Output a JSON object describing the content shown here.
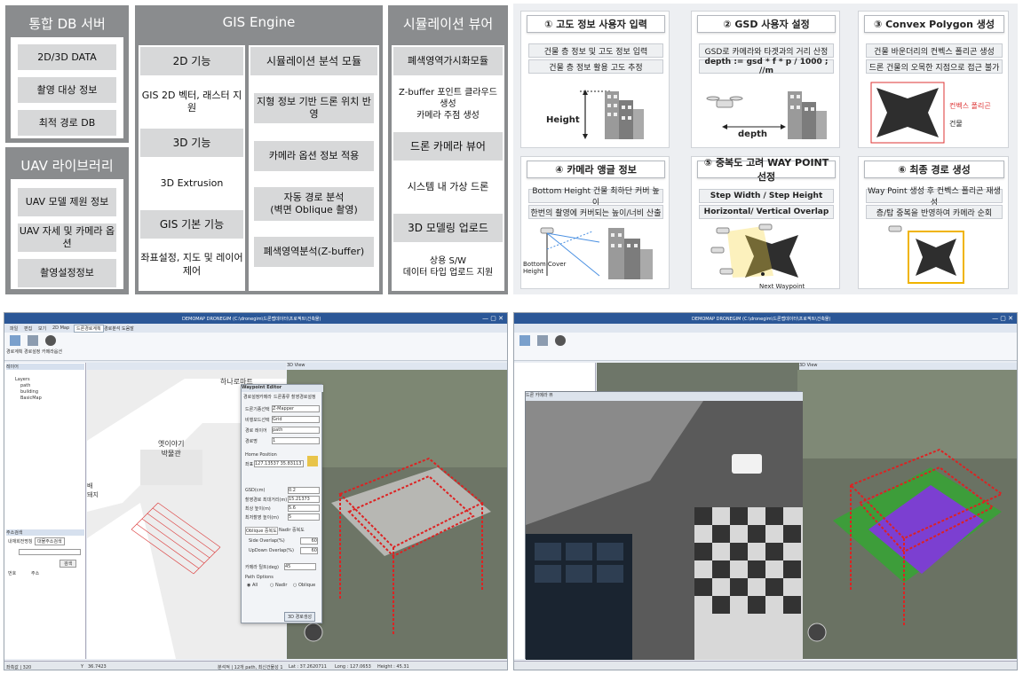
{
  "arch": {
    "db": {
      "title": "통합 DB 서버",
      "items": [
        "2D/3D DATA",
        "촬영 대상 정보",
        "최적 경로 DB"
      ]
    },
    "uav": {
      "title": "UAV 라이브러리",
      "items": [
        "UAV 모델 제원 정보",
        "UAV 자세 및 카메라 옵션",
        "촬영설정정보"
      ]
    },
    "gis": {
      "title": "GIS Engine",
      "c2d": {
        "title": "2D 기능",
        "body": "GIS 2D 벡터, 래스터 지원"
      },
      "c3d": {
        "title": "3D 기능",
        "body": "3D Extrusion"
      },
      "cbase": {
        "title": "GIS 기본 기능",
        "body": "좌표설정, 지도 및 레이어 제어"
      },
      "sim": {
        "title": "시뮬레이션 분석 모듈",
        "items": [
          "지형 정보 기반 드론 위치 반영",
          "카메라 옵션 정보 적용",
          "자동 경로 분석\n(벽면 Oblique 촬영)",
          "폐색영역분석(Z-buffer)"
        ]
      }
    },
    "viewer": {
      "title": "시뮬레이션 뷰어",
      "a": {
        "title": "폐색영역가시화모듈",
        "body": "Z-buffer 포인트 클라우드 생성\n카메라 주점 생성"
      },
      "b": {
        "title": "드론 카메라 뷰어",
        "body": "시스템 내 가상 드론"
      },
      "c": {
        "title": "3D 모델링 업로드",
        "body": "상용 S/W\n데이터 타입 업로드 지원"
      }
    }
  },
  "steps": [
    {
      "title": "① 고도 정보 사용자 입력",
      "rows": [
        "건물 층 정보 및 고도 정보 입력",
        "건물 층 정보 활용 고도 추정"
      ],
      "labels": [
        "Height"
      ]
    },
    {
      "title": "② GSD 사용자 설정",
      "rows": [
        "GSD로 카메라와 타겟과의 거리 산정",
        "depth := gsd * f * p / 1000 ; //m"
      ],
      "labels": [
        "depth"
      ]
    },
    {
      "title": "③ Convex Polygon 생성",
      "rows": [
        "건물 바운더리의 컨벡스 폴리곤 생성",
        "드론 건물의 오목한 지점으로 접근 불가"
      ],
      "labels": [
        "컨벡스 폴리곤",
        "건물"
      ]
    },
    {
      "title": "④ 카메라 앵글 정보",
      "rows": [
        "Bottom Height 건물 최하단 커버 높이",
        "한번의 촬영에 커버되는 높이/너비 산출"
      ],
      "labels": [
        "Bottom Cover\nHeight"
      ]
    },
    {
      "title": "⑤ 중복도 고려 WAY POINT 선정",
      "rows": [
        "Step Width / Step Height",
        "Horizontal/ Vertical Overlap"
      ],
      "labels": [
        "Next Waypoint"
      ]
    },
    {
      "title": "⑥ 최종 경로 생성",
      "rows": [
        "Way Point 생성 후 컨벡스 폴리곤 재생성",
        "층/탑 중복을 반영하여 카메라 순회"
      ],
      "labels": []
    }
  ],
  "app": {
    "title": "DEMOMAP DRONEGIM (C:\\dronegim\\드론맵데이터\\프로젝트\\건축물)",
    "menu": [
      "파일",
      "편집",
      "보기",
      "2D Map",
      "드론경로계획",
      "경로분석",
      "도움말"
    ],
    "ribbon": [
      "경로계획",
      "경로설정",
      "카메라옵션"
    ],
    "layers": {
      "title": "레이어",
      "items": [
        "Layers",
        "path",
        "building",
        "BasicMap"
      ]
    },
    "search": {
      "title": "주소검색",
      "label": "내재회전명칭",
      "select": "대물주소검색",
      "btn": "검색",
      "cols": [
        "번호",
        "주소"
      ]
    },
    "view2d": {
      "tab": "2D View",
      "labels": [
        "하나로마트",
        "옛이야기\n박물관",
        "배\n돼지"
      ]
    },
    "view3d": {
      "tab": "3D View"
    },
    "dialog": {
      "title": "Waypoint Editor",
      "tabs": [
        "경로설정",
        "카메라",
        "드론종류",
        "촬영경로설정"
      ],
      "fields": [
        {
          "label": "드론기종선택",
          "value": "Z-Mapper"
        },
        {
          "label": "비행모드선택",
          "value": "Grid"
        },
        {
          "label": "경로 레이어",
          "value": "path"
        },
        {
          "label": "경로명",
          "value": "1"
        }
      ],
      "home": {
        "label": "Home Position",
        "sub": "좌표",
        "value": "127.13537 35.83113"
      },
      "params": [
        {
          "label": "GSD(cm)",
          "value": "0.2"
        },
        {
          "label": "촬영경로 최대거리(m)",
          "value": "15.21373"
        },
        {
          "label": "최상 높이(m)",
          "value": "5.6"
        },
        {
          "label": "최저촬영 높이(m)",
          "value": "5"
        }
      ],
      "overlap": {
        "tabs": [
          "Oblique 중복도",
          "Nadir 중복도"
        ],
        "side": {
          "label": "Side Overlap(%)",
          "value": "60"
        },
        "updown": {
          "label": "UpDown Overlap(%)",
          "value": "60"
        }
      },
      "camera": {
        "label": "카메라 틸트(deg)",
        "value": "45"
      },
      "path": {
        "label": "Path Options",
        "options": [
          "All",
          "Nadir",
          "Oblique"
        ]
      },
      "btn": "3D 경로생성"
    },
    "status": [
      "좌측값 | 320",
      "Y",
      "36.7423",
      "분석적 | 12개 path, 최신건물성 1",
      "Lat : 37.2620711",
      "Long : 127.0653",
      "Height : 45.31"
    ]
  },
  "app2": {
    "title": "DEMOMAP DRONEGIM (C:\\dronegim\\드론맵데이터\\프로젝트\\건축물)",
    "dialog_title": "드론 카메라 뷰",
    "tab": "3D View"
  }
}
